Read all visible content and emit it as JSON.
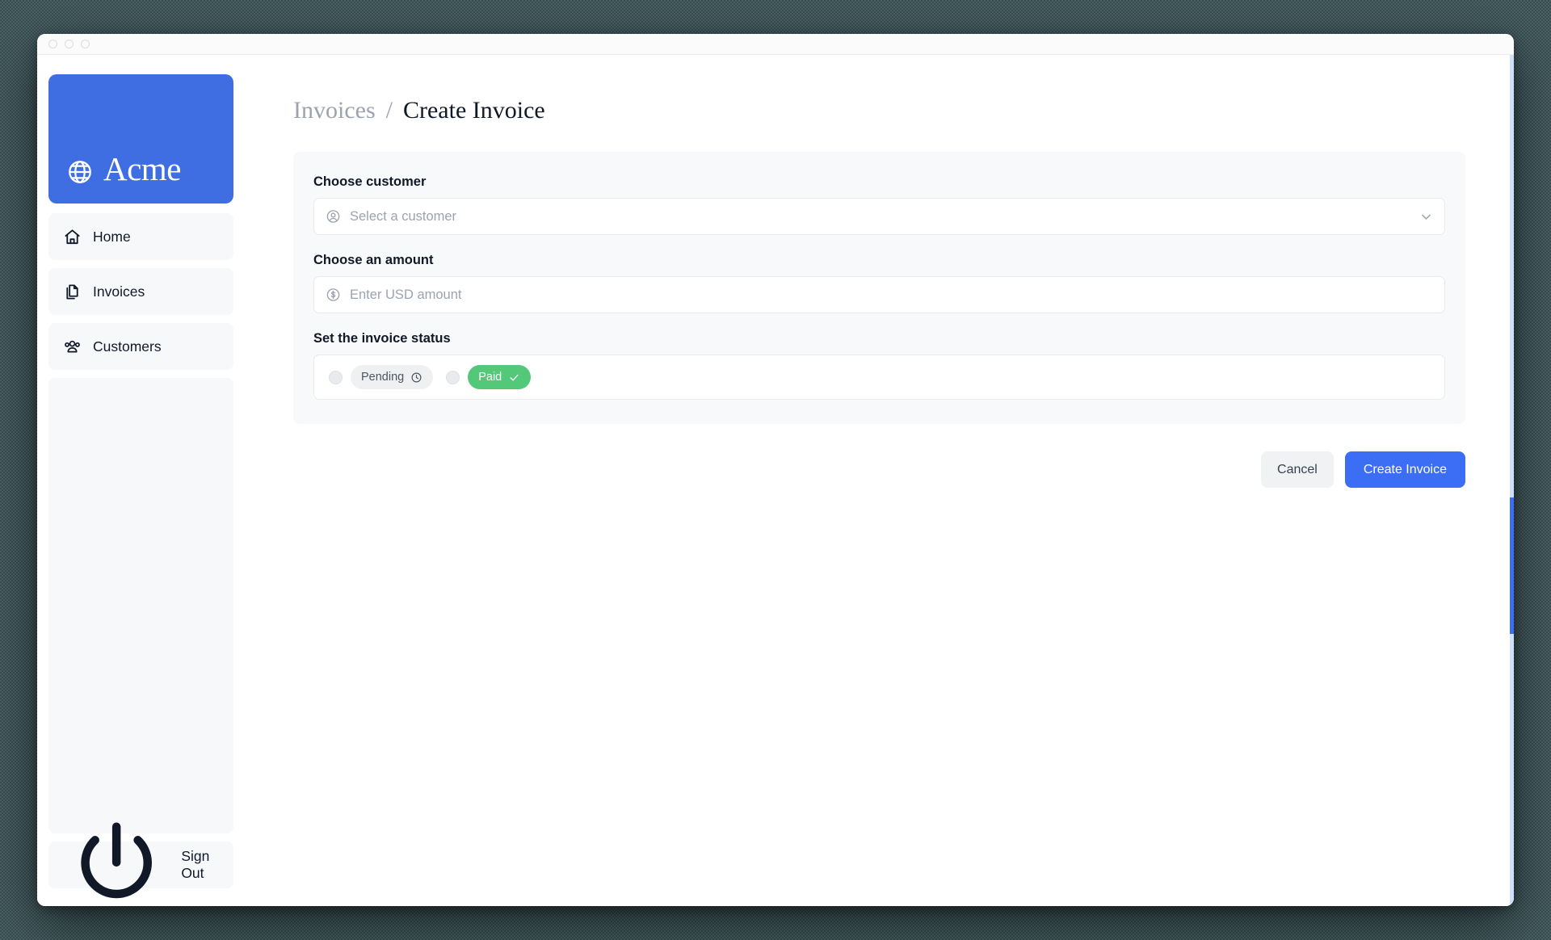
{
  "window": {
    "traffic_lights": [
      "close",
      "minimize",
      "maximize"
    ]
  },
  "sidebar": {
    "logo": {
      "text": "Acme",
      "icon": "globe-icon",
      "background_color": "#3f6ee3"
    },
    "items": [
      {
        "label": "Home",
        "icon": "home-icon"
      },
      {
        "label": "Invoices",
        "icon": "document-duplicate-icon"
      },
      {
        "label": "Customers",
        "icon": "users-icon"
      }
    ],
    "sign_out": {
      "label": "Sign Out",
      "icon": "power-icon"
    }
  },
  "breadcrumb": {
    "parent": "Invoices",
    "separator": "/",
    "current": "Create Invoice"
  },
  "form": {
    "customer": {
      "label": "Choose customer",
      "placeholder": "Select a customer",
      "value": "",
      "lead_icon": "user-circle-icon",
      "trail_icon": "chevron-down-icon"
    },
    "amount": {
      "label": "Choose an amount",
      "placeholder": "Enter USD amount",
      "value": "",
      "lead_icon": "currency-dollar-icon"
    },
    "status": {
      "label": "Set the invoice status",
      "options": [
        {
          "label": "Pending",
          "icon": "clock-icon",
          "selected": false
        },
        {
          "label": "Paid",
          "icon": "check-icon",
          "selected": false
        }
      ]
    }
  },
  "actions": {
    "cancel_label": "Cancel",
    "create_label": "Create Invoice"
  },
  "colors": {
    "brand_blue": "#3f6ee3",
    "primary_button": "#3b6ef5",
    "paid_green": "#52c878",
    "card_background": "#f8f9fb",
    "desktop_background": "#3f5559"
  }
}
